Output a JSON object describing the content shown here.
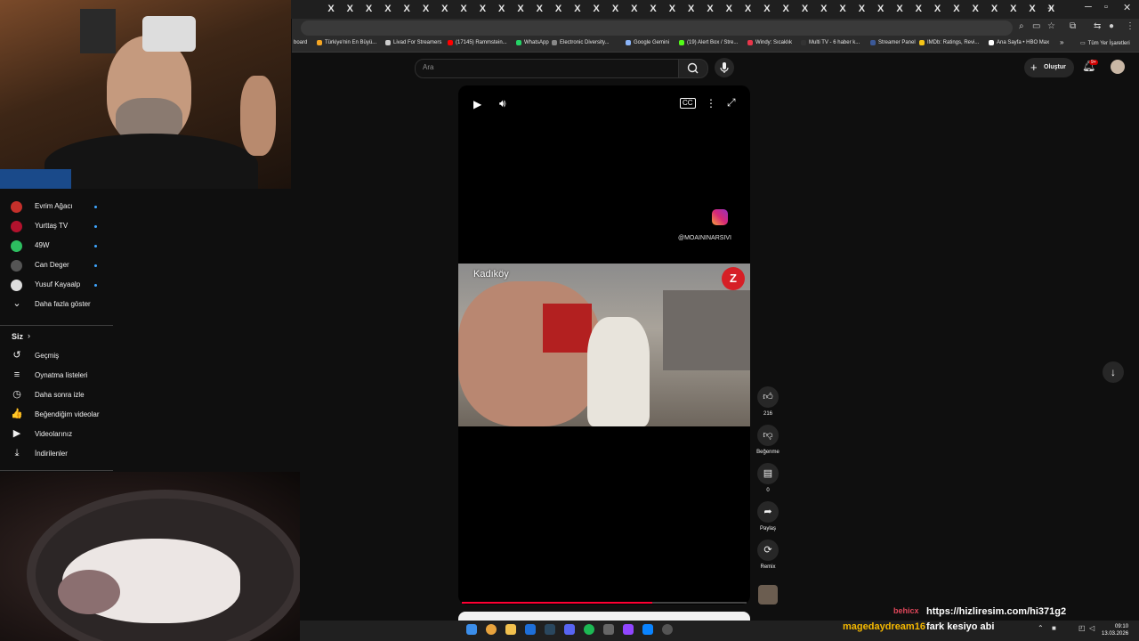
{
  "browser": {
    "tab_count_close_glyph": "X",
    "bookmarks": [
      {
        "label": "board",
        "color": "#4c8bf5"
      },
      {
        "label": "Türkiye'nin En Büyü...",
        "color": "#f5a623"
      },
      {
        "label": "Livad For Streamers",
        "color": "#cccccc"
      },
      {
        "label": "(17145) Rammstein...",
        "color": "#ff0000"
      },
      {
        "label": "WhatsApp",
        "color": "#25d366"
      },
      {
        "label": "Electronic Diversity...",
        "color": "#888888"
      },
      {
        "label": "Google Gemini",
        "color": "#8ab4f8"
      },
      {
        "label": "(19) Alert Box / Stre...",
        "color": "#53fc18"
      },
      {
        "label": "Windy: Sıcaklık",
        "color": "#e8364a"
      },
      {
        "label": "Multi TV - 6 haber k...",
        "color": "#333333"
      },
      {
        "label": "Streamer Panel",
        "color": "#3b5998"
      },
      {
        "label": "IMDb: Ratings, Revi...",
        "color": "#f5c518"
      },
      {
        "label": "Ana Sayfa • HBO Max",
        "color": "#ffffff"
      }
    ],
    "more_bookmarks": "»",
    "all_bookmarks": "Tüm Yer İşaretleri"
  },
  "youtube": {
    "search_placeholder": "Ara",
    "create_label": "Oluştur",
    "notification_count": "9+"
  },
  "sidebar": {
    "subscriptions": [
      {
        "label": "Evrim Ağacı",
        "color": "#c4302b"
      },
      {
        "label": "Yurttaş TV",
        "color": "#b3122d"
      },
      {
        "label": "49W",
        "color": "#2dbe60"
      },
      {
        "label": "Can Deger",
        "color": "#555555"
      },
      {
        "label": "Yusuf Kayaalp",
        "color": "#dddddd"
      }
    ],
    "show_more": "Daha fazla göster",
    "you_header": "Siz",
    "you_items": [
      {
        "label": "Geçmiş",
        "icon": "history-icon",
        "glyph": "↺"
      },
      {
        "label": "Oynatma listeleri",
        "icon": "playlist-icon",
        "glyph": "≡"
      },
      {
        "label": "Daha sonra izle",
        "icon": "clock-icon",
        "glyph": "◷"
      },
      {
        "label": "Beğendiğim videolar",
        "icon": "thumb-up-icon",
        "glyph": "👍"
      },
      {
        "label": "Videolarınız",
        "icon": "video-icon",
        "glyph": "▶"
      },
      {
        "label": "İndirilenler",
        "icon": "download-icon",
        "glyph": "⤓"
      }
    ]
  },
  "player": {
    "watermark": "@MOAININARSIVI",
    "location_tag": "Kadıköy",
    "progress": 0.67
  },
  "actions": {
    "likes": "216",
    "dislike_label": "Beğenme",
    "comments": "0",
    "share_label": "Paylaş",
    "remix_label": "Remix"
  },
  "chat": [
    {
      "user": "behicx",
      "message": "https://hizliresim.com/hi371g2",
      "user_color": "#e0475a"
    },
    {
      "user": "magedaydream16",
      "message": "fark kesiyo abi",
      "user_color": "#f5b800"
    }
  ],
  "taskbar": {
    "time": "09:10",
    "date": "13.03.2026"
  }
}
